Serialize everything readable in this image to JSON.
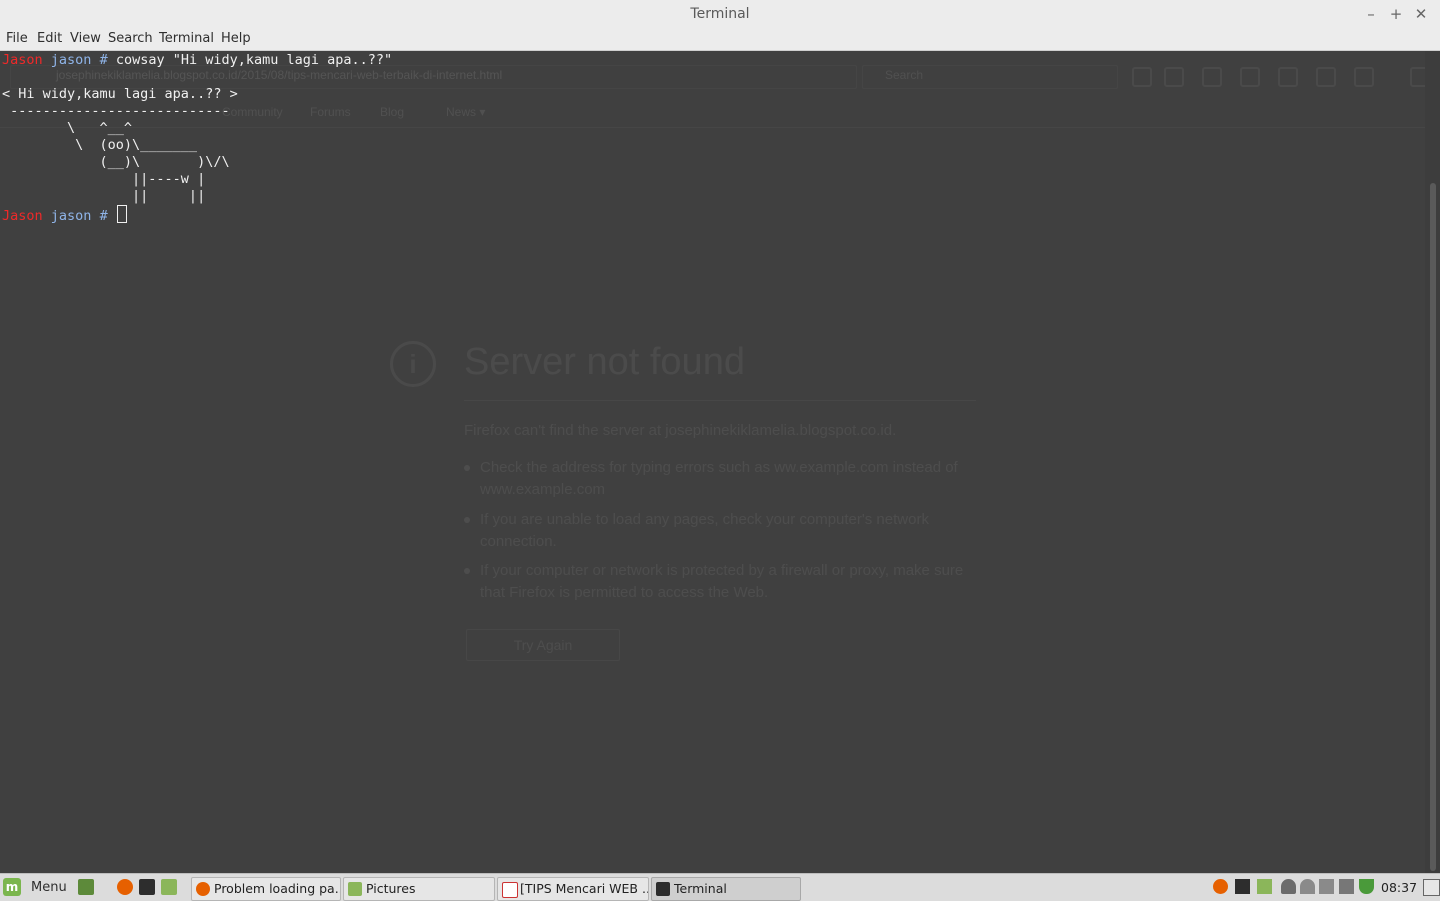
{
  "window": {
    "title": "Terminal",
    "controls": [
      "–",
      "+",
      "✕"
    ]
  },
  "menubar": [
    "File",
    "Edit",
    "View",
    "Search",
    "Terminal",
    "Help"
  ],
  "terminal": {
    "prompt1": {
      "host": "Jason",
      "user": "jason",
      "hash": "#",
      "command": "cowsay \"Hi widy,kamu lagi apa..??\""
    },
    "output": [
      "< Hi widy,kamu lagi apa..?? >",
      " ---------------------------",
      "        \\   ^__^",
      "         \\  (oo)\\_______",
      "            (__)\\       )\\/\\",
      "                ||----w |",
      "                ||     ||"
    ],
    "prompt2": {
      "host": "Jason",
      "user": "jason",
      "hash": "#"
    }
  },
  "background_browser": {
    "url": "josephinekiklamelia.blogspot.co.id/2015/08/tips-mencari-web-terbaik-di-internet.html",
    "search_placeholder": "Search",
    "bookmarks": [
      "Community",
      "Forums",
      "Blog",
      "News ▾"
    ],
    "error_title": "Server not found",
    "error_message": "Firefox can't find the server at josephinekiklamelia.blogspot.co.id.",
    "bullets": [
      "Check the address for typing errors such as ww.example.com instead of www.example.com",
      "If you are unable to load any pages, check your computer's network connection.",
      "If your computer or network is protected by a firewall or proxy, make sure that Firefox is permitted to access the Web."
    ],
    "try_again": "Try Again"
  },
  "taskbar": {
    "menu_label": "Menu",
    "tasks": [
      {
        "label": "Problem loading pa...",
        "icon": "firefox-icon"
      },
      {
        "label": "Pictures",
        "icon": "folder-icon"
      },
      {
        "label": "[TIPS Mencari WEB ...",
        "icon": "document-icon"
      },
      {
        "label": "Terminal",
        "icon": "terminal-icon"
      }
    ],
    "clock": "08:37"
  },
  "colors": {
    "terminal_bg": "#404040",
    "prompt_host": "#ef2929",
    "prompt_user": "#8fb4e8",
    "mint_green": "#7bb64e"
  }
}
